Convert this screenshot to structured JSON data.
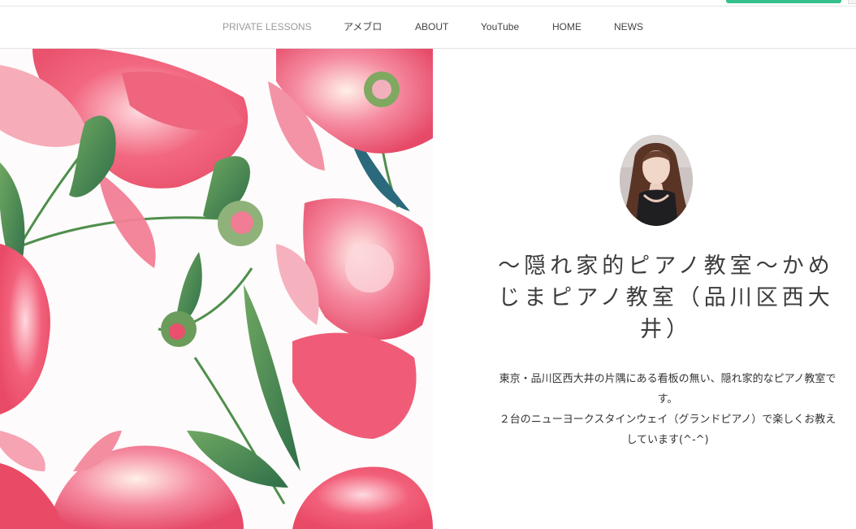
{
  "nav": {
    "items": [
      {
        "label": "PRIVATE LESSONS",
        "active": true
      },
      {
        "label": "アメブロ",
        "active": false
      },
      {
        "label": "ABOUT",
        "active": false
      },
      {
        "label": "YouTube",
        "active": false
      },
      {
        "label": "HOME",
        "active": false
      },
      {
        "label": "NEWS",
        "active": false
      }
    ]
  },
  "hero": {
    "image": "watercolor-peonies-illustration",
    "title": "～隠れ家的ピアノ教室～かめじまピアノ教室（品川区西大井）",
    "description_lines": [
      "東京・品川区西大井の片隅にある看板の無い、隠れ家的なピアノ教室です。",
      "２台のニューヨークスタインウェイ（グランドピアノ）で楽しくお教えしています(^-^)"
    ]
  },
  "profile": {
    "image": "profile-photo-woman-black-dress"
  },
  "colors": {
    "accent": "#33c08a",
    "nav_text": "#444444",
    "nav_muted": "#9a9a9a",
    "title_text": "#3c3c3c",
    "peony_pink": "#f2607a",
    "leaf_green": "#3f8a4e"
  }
}
